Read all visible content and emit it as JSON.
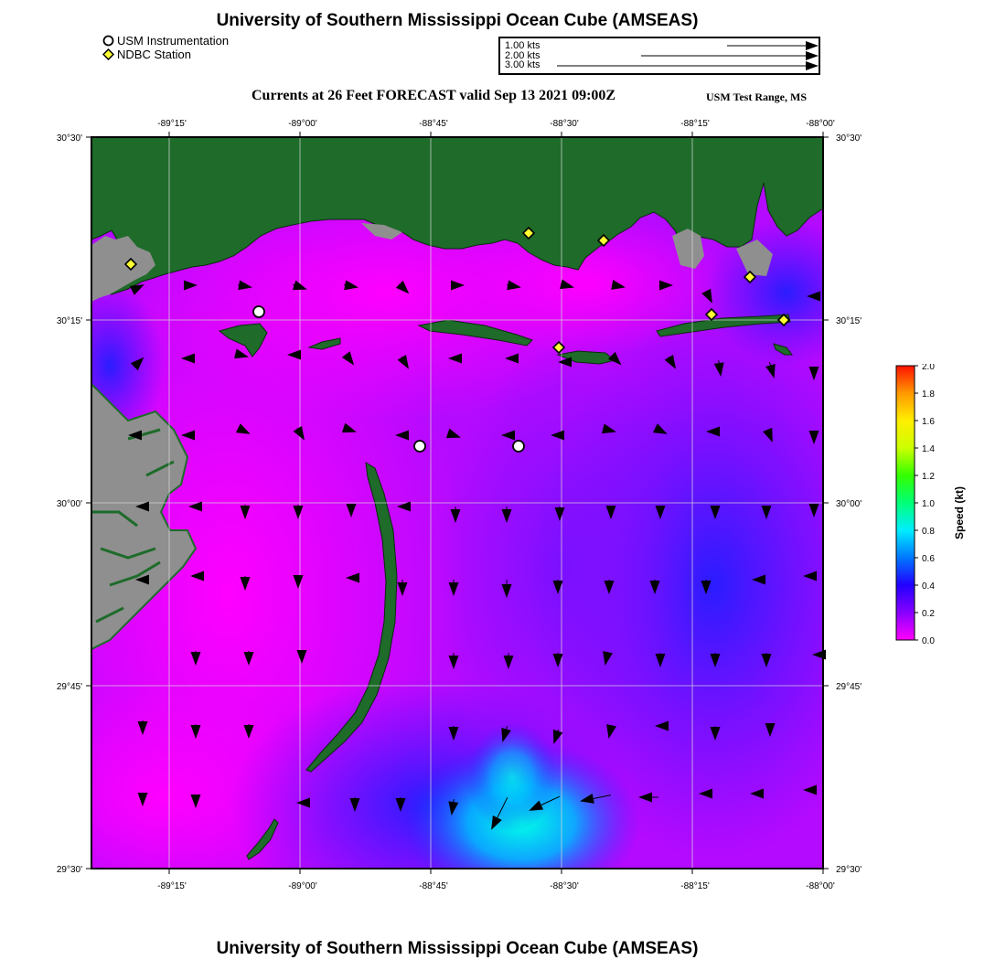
{
  "header": {
    "title": "University of Southern Mississippi Ocean Cube (AMSEAS)",
    "subtitle": "Currents at 26 Feet FORECAST valid Sep 13 2021 09:00Z",
    "region": "USM Test Range, MS"
  },
  "legend": {
    "usm_instrumentation": "USM Instrumentation",
    "ndbc_station": "NDBC Station"
  },
  "vector_legend": [
    {
      "label": "1.00 kts",
      "value": 1.0
    },
    {
      "label": "2.00 kts",
      "value": 2.0
    },
    {
      "label": "3.00 kts",
      "value": 3.0
    }
  ],
  "map": {
    "lon_ticks": [
      "-89°15'",
      "-89°00'",
      "-88°45'",
      "-88°30'",
      "-88°15'",
      "-88°00'"
    ],
    "lat_ticks_left": [
      "30°30'",
      "30°15'",
      "30°00'",
      "29°45'",
      "29°30'"
    ],
    "lat_ticks_right": [
      "30°30'",
      "30°15'",
      "30°00'",
      "29°45'",
      "29°30'"
    ],
    "colors": {
      "land": "#1e6b2a",
      "marsh": "#8f8f8f",
      "grid": "#d8d8d8",
      "usm_marker": "#ffffff",
      "ndbc_marker": "#ffff33"
    }
  },
  "colorbar": {
    "label": "Speed (kt)",
    "ticks": [
      "2.0",
      "1.8",
      "1.6",
      "1.4",
      "1.2",
      "1.0",
      "0.8",
      "0.6",
      "0.4",
      "0.2",
      "0.0"
    ],
    "range": [
      0,
      2
    ],
    "stops": [
      "#ff00ff",
      "#8800ff",
      "#2200ff",
      "#0077ff",
      "#00eeff",
      "#00ff77",
      "#33ff00",
      "#ccff00",
      "#ffee00",
      "#ff9900",
      "#ff1100"
    ]
  },
  "footer": {
    "title": "University of Southern Mississippi Ocean Cube (AMSEAS)"
  }
}
